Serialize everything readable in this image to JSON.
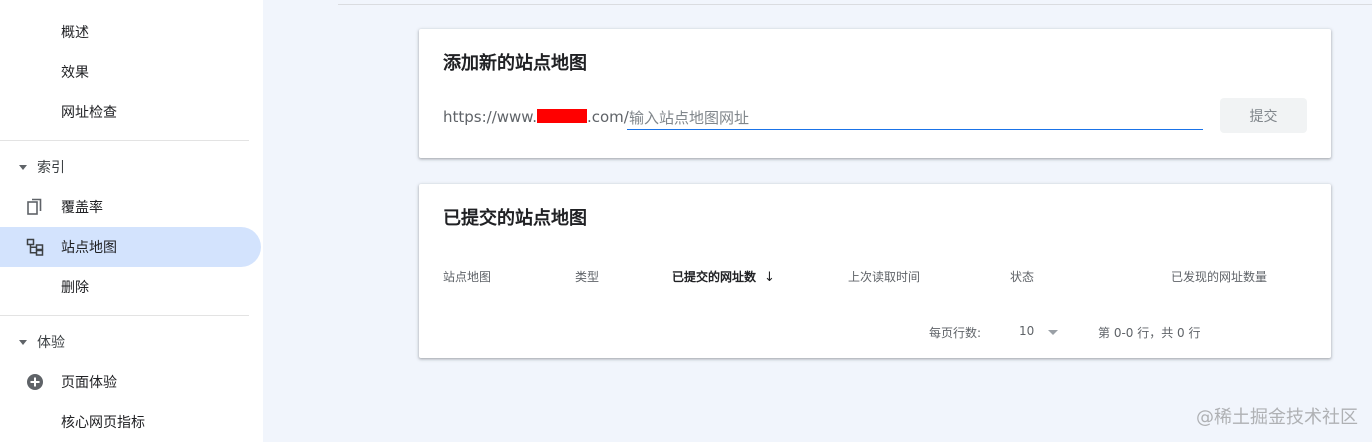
{
  "sidebar": {
    "top_items": [
      {
        "label": "概述"
      },
      {
        "label": "效果"
      },
      {
        "label": "网址检查"
      }
    ],
    "index_section": {
      "title": "索引",
      "items": [
        {
          "label": "覆盖率",
          "icon": "copy-pages-icon"
        },
        {
          "label": "站点地图",
          "icon": "sitemap-icon",
          "active": true
        },
        {
          "label": "删除"
        }
      ]
    },
    "experience_section": {
      "title": "体验",
      "items": [
        {
          "label": "页面体验",
          "icon": "plus-circle-icon"
        },
        {
          "label": "核心网页指标"
        }
      ]
    }
  },
  "add_sitemap": {
    "title": "添加新的站点地图",
    "url_prefix_start": "https://www.",
    "url_prefix_end": ".com/",
    "input_placeholder": "输入站点地图网址",
    "input_value": "",
    "submit_label": "提交"
  },
  "submitted": {
    "title": "已提交的站点地图",
    "columns": [
      "站点地图",
      "类型",
      "已提交的网址数",
      "上次读取时间",
      "状态",
      "已发现的网址数量"
    ],
    "sorted_column_index": 2,
    "sort_icon": "arrow-down-icon",
    "rows": [],
    "pager": {
      "rows_per_page_label": "每页行数:",
      "rows_per_page_value": "10",
      "range_text": "第 0-0 行，共 0 行"
    }
  },
  "colors": {
    "active_nav_bg": "#d3e3fd",
    "accent": "#1a73e8",
    "page_bg": "#f1f5fc",
    "redaction": "#ff0000"
  },
  "watermark": "@稀土掘金技术社区"
}
